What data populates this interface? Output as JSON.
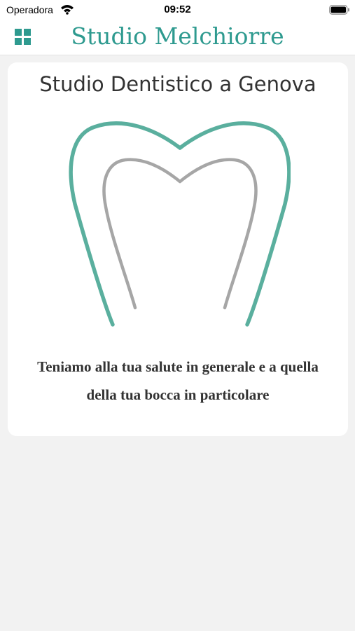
{
  "status_bar": {
    "carrier": "Operadora",
    "time": "09:52",
    "icons": [
      "wifi-icon",
      "battery-icon"
    ]
  },
  "nav": {
    "title": "Studio Melchiorre",
    "menu_icon": "grid-menu-icon"
  },
  "card": {
    "title": "Studio Dentistico a Genova",
    "logo": "tooth-logo",
    "tagline": "Teniamo alla tua salute in generale e a quella della tua bocca in particolare"
  },
  "colors": {
    "accent": "#2e9a8f",
    "logo_outer": "#5aaf9e",
    "logo_inner": "#a6a6a6",
    "background": "#f2f2f2"
  }
}
